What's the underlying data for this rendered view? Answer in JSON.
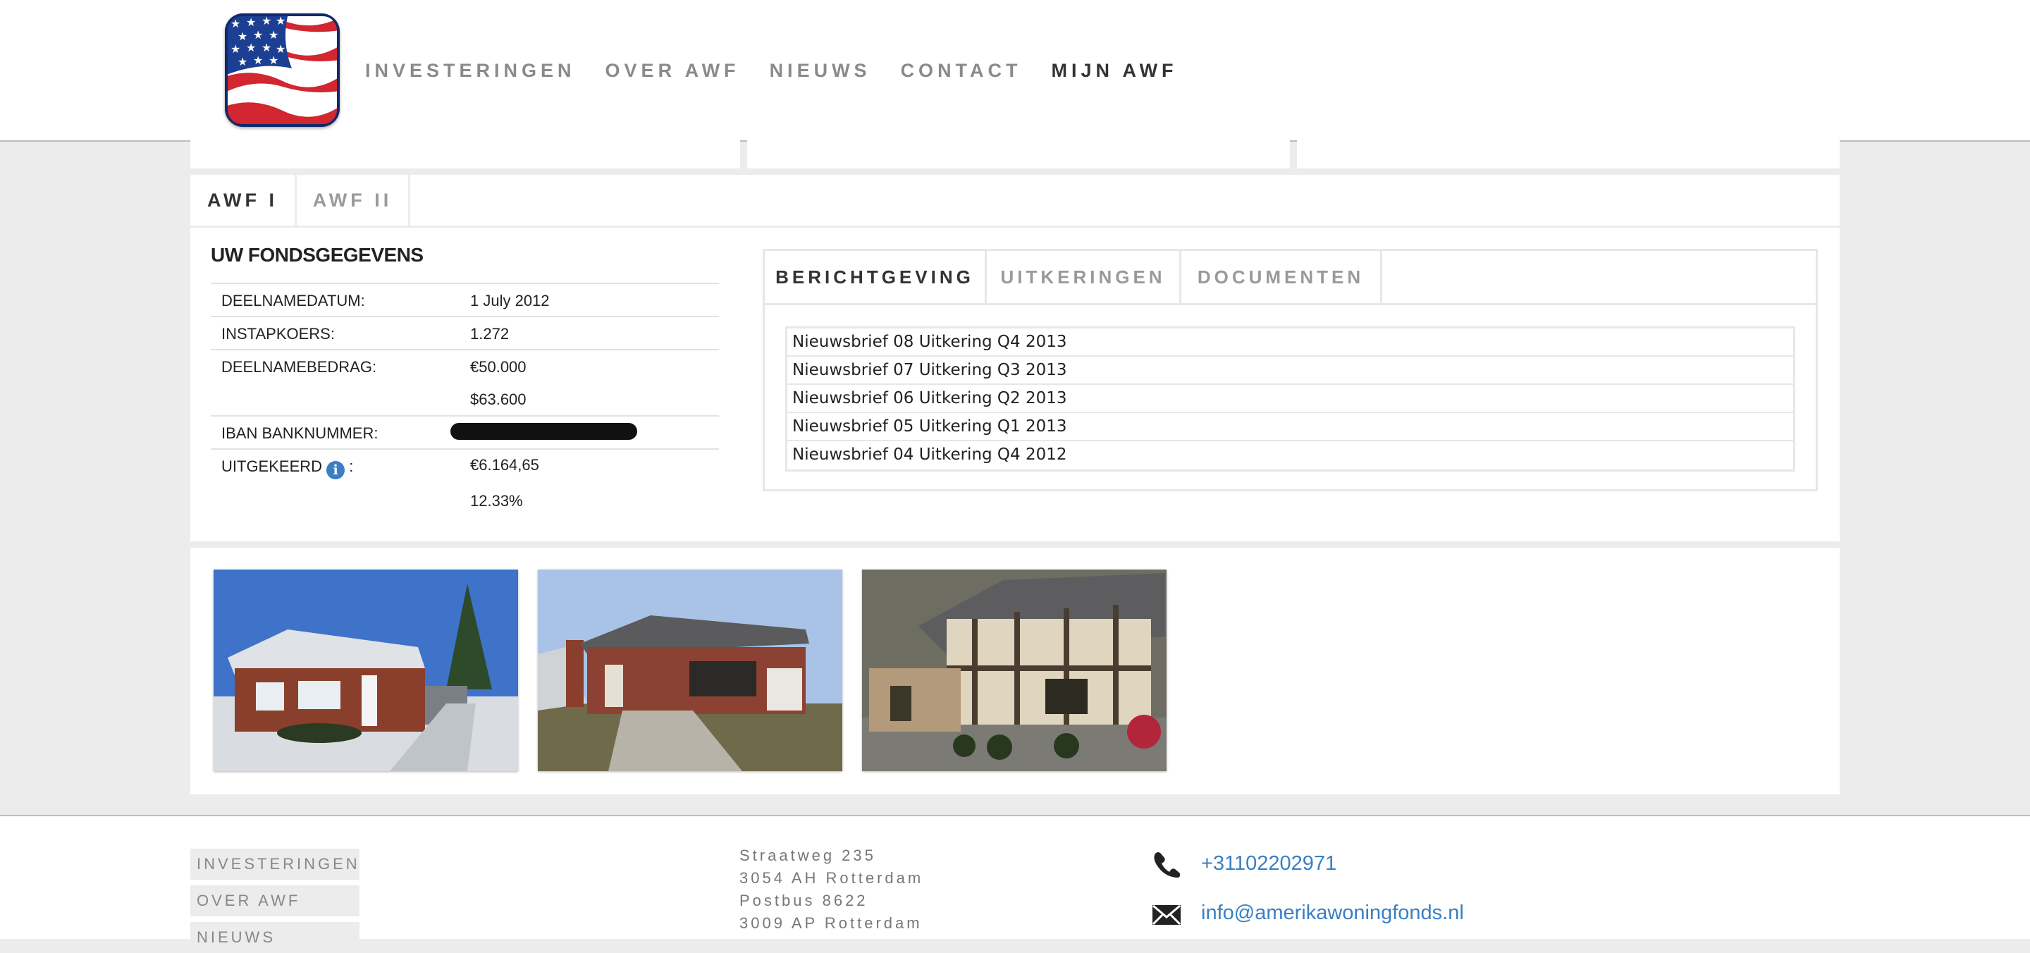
{
  "nav": {
    "items": [
      {
        "label": "INVESTERINGEN",
        "active": false
      },
      {
        "label": "OVER AWF",
        "active": false
      },
      {
        "label": "NIEUWS",
        "active": false
      },
      {
        "label": "CONTACT",
        "active": false
      },
      {
        "label": "MIJN AWF",
        "active": true
      }
    ]
  },
  "fund_tabs": [
    {
      "label": "AWF I",
      "active": true
    },
    {
      "label": "AWF II",
      "active": false
    }
  ],
  "fund": {
    "title": "UW FONDSGEGEVENS",
    "rows": [
      {
        "label": "DEELNAMEDATUM:",
        "value": "1 July 2012"
      },
      {
        "label": "INSTAPKOERS:",
        "value": "1.272"
      },
      {
        "label": "DEELNAMEBEDRAG:",
        "value": "€50.000",
        "value2": "$63.600"
      },
      {
        "label": "IBAN BANKNUMMER:",
        "value": ""
      },
      {
        "label": "UITGEKEERD",
        "suffix": " :",
        "value": "€6.164,65",
        "value2": "12.33%"
      }
    ]
  },
  "doc_tabs": [
    {
      "label": "BERICHTGEVING",
      "active": true
    },
    {
      "label": "UITKERINGEN",
      "active": false
    },
    {
      "label": "DOCUMENTEN",
      "active": false
    }
  ],
  "news": [
    "Nieuwsbrief 08 Uitkering Q4 2013",
    "Nieuwsbrief 07 Uitkering Q3 2013",
    "Nieuwsbrief 06 Uitkering Q2 2013",
    "Nieuwsbrief 05 Uitkering Q1 2013",
    "Nieuwsbrief 04 Uitkering Q4 2012"
  ],
  "footer": {
    "links": [
      "INVESTERINGEN",
      "OVER AWF",
      "NIEUWS"
    ],
    "address": [
      "Straatweg 235",
      "3054 AH Rotterdam",
      "Postbus 8622",
      "3009 AP Rotterdam"
    ],
    "phone": "+31102202971",
    "email": "info@amerikawoningfonds.nl"
  },
  "icons": {
    "logo": "us-flag-logo",
    "info": "info-icon",
    "phone": "phone-icon",
    "email": "envelope-icon"
  },
  "colors": {
    "accent": "#3a7fc4",
    "background": "#ececec"
  }
}
